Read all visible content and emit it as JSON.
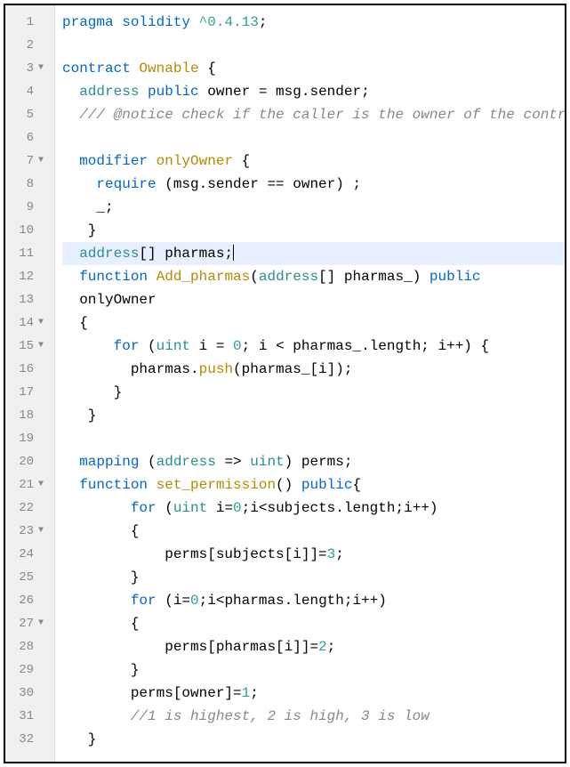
{
  "lines": [
    {
      "n": 1,
      "fold": "",
      "active": false,
      "tokens": [
        {
          "t": "kw",
          "v": "pragma"
        },
        {
          "t": "p",
          "v": " "
        },
        {
          "t": "kw",
          "v": "solidity"
        },
        {
          "t": "p",
          "v": " "
        },
        {
          "t": "num",
          "v": "^0.4.13"
        },
        {
          "t": "p",
          "v": ";"
        }
      ]
    },
    {
      "n": 2,
      "fold": "",
      "active": false,
      "tokens": []
    },
    {
      "n": 3,
      "fold": "▼",
      "active": false,
      "tokens": [
        {
          "t": "kw",
          "v": "contract"
        },
        {
          "t": "p",
          "v": " "
        },
        {
          "t": "fn",
          "v": "Ownable"
        },
        {
          "t": "p",
          "v": " {"
        }
      ]
    },
    {
      "n": 4,
      "fold": "",
      "active": false,
      "tokens": [
        {
          "t": "p",
          "v": "  "
        },
        {
          "t": "type",
          "v": "address"
        },
        {
          "t": "p",
          "v": " "
        },
        {
          "t": "kw",
          "v": "public"
        },
        {
          "t": "p",
          "v": " owner = msg.sender;"
        }
      ]
    },
    {
      "n": 5,
      "fold": "",
      "active": false,
      "tokens": [
        {
          "t": "p",
          "v": "  "
        },
        {
          "t": "comment",
          "v": "/// @notice check if the caller is the owner of the contract"
        }
      ]
    },
    {
      "n": 6,
      "fold": "",
      "active": false,
      "tokens": []
    },
    {
      "n": 7,
      "fold": "▼",
      "active": false,
      "tokens": [
        {
          "t": "p",
          "v": "  "
        },
        {
          "t": "kw",
          "v": "modifier"
        },
        {
          "t": "p",
          "v": " "
        },
        {
          "t": "fn",
          "v": "onlyOwner"
        },
        {
          "t": "p",
          "v": " {"
        }
      ]
    },
    {
      "n": 8,
      "fold": "",
      "active": false,
      "tokens": [
        {
          "t": "p",
          "v": "    "
        },
        {
          "t": "kw",
          "v": "require"
        },
        {
          "t": "p",
          "v": " (msg.sender == owner) ;"
        }
      ]
    },
    {
      "n": 9,
      "fold": "",
      "active": false,
      "tokens": [
        {
          "t": "p",
          "v": "    _;"
        }
      ]
    },
    {
      "n": 10,
      "fold": "",
      "active": false,
      "tokens": [
        {
          "t": "p",
          "v": "   }"
        }
      ]
    },
    {
      "n": 11,
      "fold": "",
      "active": true,
      "tokens": [
        {
          "t": "p",
          "v": "  "
        },
        {
          "t": "type",
          "v": "address"
        },
        {
          "t": "p",
          "v": "[] pharmas;"
        },
        {
          "t": "cursor",
          "v": ""
        }
      ]
    },
    {
      "n": 12,
      "fold": "",
      "active": false,
      "tokens": [
        {
          "t": "p",
          "v": "  "
        },
        {
          "t": "kw",
          "v": "function"
        },
        {
          "t": "p",
          "v": " "
        },
        {
          "t": "fn",
          "v": "Add_pharmas"
        },
        {
          "t": "p",
          "v": "("
        },
        {
          "t": "type",
          "v": "address"
        },
        {
          "t": "p",
          "v": "[] pharmas_) "
        },
        {
          "t": "kw",
          "v": "public"
        }
      ]
    },
    {
      "n": 13,
      "fold": "",
      "active": false,
      "tokens": [
        {
          "t": "p",
          "v": "  onlyOwner"
        }
      ]
    },
    {
      "n": 14,
      "fold": "▼",
      "active": false,
      "tokens": [
        {
          "t": "p",
          "v": "  {"
        }
      ]
    },
    {
      "n": 15,
      "fold": "▼",
      "active": false,
      "tokens": [
        {
          "t": "p",
          "v": "      "
        },
        {
          "t": "kw",
          "v": "for"
        },
        {
          "t": "p",
          "v": " ("
        },
        {
          "t": "type",
          "v": "uint"
        },
        {
          "t": "p",
          "v": " i = "
        },
        {
          "t": "num",
          "v": "0"
        },
        {
          "t": "p",
          "v": "; i < pharmas_.length; i++) {"
        }
      ]
    },
    {
      "n": 16,
      "fold": "",
      "active": false,
      "tokens": [
        {
          "t": "p",
          "v": "        pharmas."
        },
        {
          "t": "fn",
          "v": "push"
        },
        {
          "t": "p",
          "v": "(pharmas_[i]);"
        }
      ]
    },
    {
      "n": 17,
      "fold": "",
      "active": false,
      "tokens": [
        {
          "t": "p",
          "v": "      }"
        }
      ]
    },
    {
      "n": 18,
      "fold": "",
      "active": false,
      "tokens": [
        {
          "t": "p",
          "v": "   }"
        }
      ]
    },
    {
      "n": 19,
      "fold": "",
      "active": false,
      "tokens": []
    },
    {
      "n": 20,
      "fold": "",
      "active": false,
      "tokens": [
        {
          "t": "p",
          "v": "  "
        },
        {
          "t": "kw",
          "v": "mapping"
        },
        {
          "t": "p",
          "v": " ("
        },
        {
          "t": "type",
          "v": "address"
        },
        {
          "t": "p",
          "v": " => "
        },
        {
          "t": "type",
          "v": "uint"
        },
        {
          "t": "p",
          "v": ") perms;"
        }
      ]
    },
    {
      "n": 21,
      "fold": "▼",
      "active": false,
      "tokens": [
        {
          "t": "p",
          "v": "  "
        },
        {
          "t": "kw",
          "v": "function"
        },
        {
          "t": "p",
          "v": " "
        },
        {
          "t": "fn",
          "v": "set_permission"
        },
        {
          "t": "p",
          "v": "() "
        },
        {
          "t": "kw",
          "v": "public"
        },
        {
          "t": "p",
          "v": "{"
        }
      ]
    },
    {
      "n": 22,
      "fold": "",
      "active": false,
      "tokens": [
        {
          "t": "p",
          "v": "        "
        },
        {
          "t": "kw",
          "v": "for"
        },
        {
          "t": "p",
          "v": " ("
        },
        {
          "t": "type",
          "v": "uint"
        },
        {
          "t": "p",
          "v": " i="
        },
        {
          "t": "num",
          "v": "0"
        },
        {
          "t": "p",
          "v": ";i<subjects.length;i++)"
        }
      ]
    },
    {
      "n": 23,
      "fold": "▼",
      "active": false,
      "tokens": [
        {
          "t": "p",
          "v": "        {"
        }
      ]
    },
    {
      "n": 24,
      "fold": "",
      "active": false,
      "tokens": [
        {
          "t": "p",
          "v": "            perms[subjects[i]]="
        },
        {
          "t": "num",
          "v": "3"
        },
        {
          "t": "p",
          "v": ";"
        }
      ]
    },
    {
      "n": 25,
      "fold": "",
      "active": false,
      "tokens": [
        {
          "t": "p",
          "v": "        }"
        }
      ]
    },
    {
      "n": 26,
      "fold": "",
      "active": false,
      "tokens": [
        {
          "t": "p",
          "v": "        "
        },
        {
          "t": "kw",
          "v": "for"
        },
        {
          "t": "p",
          "v": " (i="
        },
        {
          "t": "num",
          "v": "0"
        },
        {
          "t": "p",
          "v": ";i<pharmas.length;i++)"
        }
      ]
    },
    {
      "n": 27,
      "fold": "▼",
      "active": false,
      "tokens": [
        {
          "t": "p",
          "v": "        {"
        }
      ]
    },
    {
      "n": 28,
      "fold": "",
      "active": false,
      "tokens": [
        {
          "t": "p",
          "v": "            perms[pharmas[i]]="
        },
        {
          "t": "num",
          "v": "2"
        },
        {
          "t": "p",
          "v": ";"
        }
      ]
    },
    {
      "n": 29,
      "fold": "",
      "active": false,
      "tokens": [
        {
          "t": "p",
          "v": "        }"
        }
      ]
    },
    {
      "n": 30,
      "fold": "",
      "active": false,
      "tokens": [
        {
          "t": "p",
          "v": "        perms[owner]="
        },
        {
          "t": "num",
          "v": "1"
        },
        {
          "t": "p",
          "v": ";"
        }
      ]
    },
    {
      "n": 31,
      "fold": "",
      "active": false,
      "tokens": [
        {
          "t": "p",
          "v": "        "
        },
        {
          "t": "comment",
          "v": "//1 is highest, 2 is high, 3 is low"
        }
      ]
    },
    {
      "n": 32,
      "fold": "",
      "active": false,
      "tokens": [
        {
          "t": "p",
          "v": "   }"
        }
      ]
    }
  ]
}
